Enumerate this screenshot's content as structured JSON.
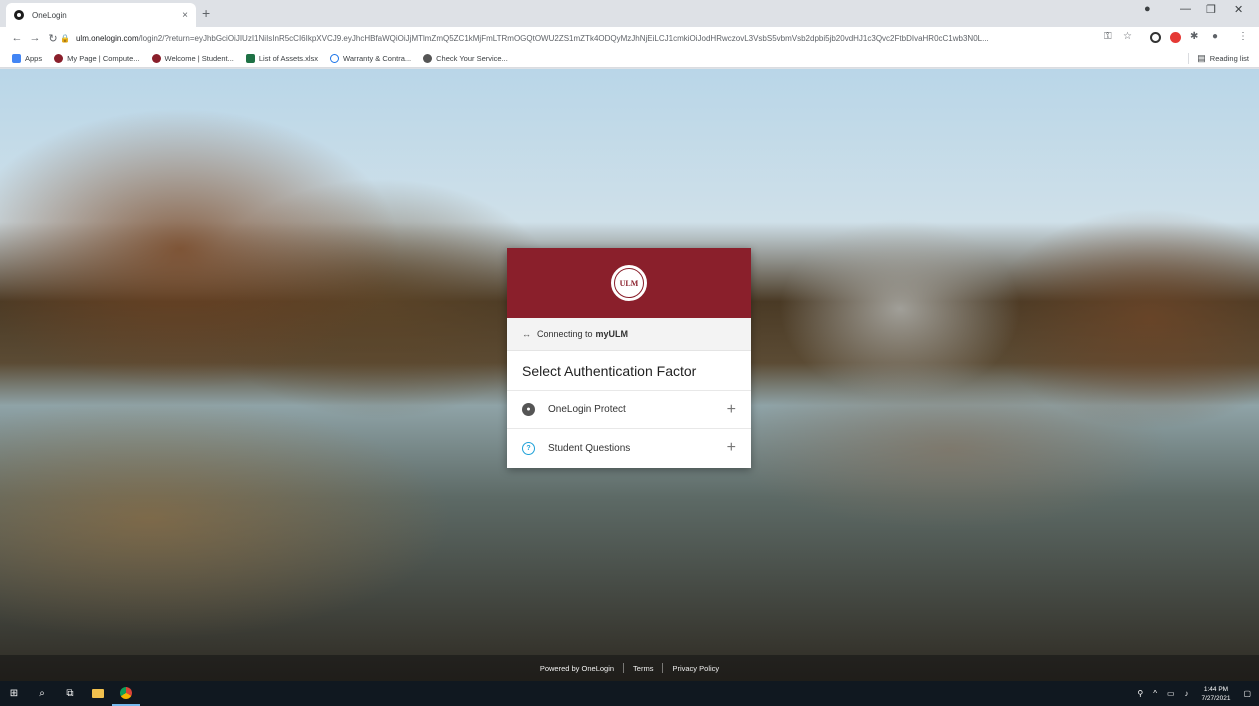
{
  "browser": {
    "tab_title": "OneLogin",
    "tab_close": "×",
    "new_tab": "+",
    "url_host": "ulm.onelogin.com",
    "url_path": "/login2/?return=eyJhbGciOiJIUzI1NiIsInR5cCI6IkpXVCJ9.eyJhcHBfaWQiOiJjMTlmZmQ5ZC1kMjFmLTRmOGQtOWU2ZS1mZTk4ODQyMzJhNjEiLCJ1cmkiOiJodHRwczovL3VsbS5vbmVsb2dpbi5jb20vdHJ1c3Qvc2FtbDIvaHR0cC1wb3N0L..."
  },
  "bookmarks": {
    "items": [
      {
        "label": "Apps",
        "color": "#4285f4"
      },
      {
        "label": "My Page | Compute...",
        "color": "#8a1f2b"
      },
      {
        "label": "Welcome | Student...",
        "color": "#8a1f2b"
      },
      {
        "label": "List of Assets.xlsx",
        "color": "#1e7145"
      },
      {
        "label": "Warranty & Contra...",
        "color": "#1a73e8"
      },
      {
        "label": "Check Your Service...",
        "color": "#555555"
      }
    ],
    "reading_list": "Reading list"
  },
  "card": {
    "logo_text": "ULM",
    "connecting_prefix": "Connecting to",
    "connecting_app": "myULM",
    "title": "Select Authentication Factor",
    "factors": [
      {
        "label": "OneLogin Protect",
        "icon": "onelogin-protect-icon",
        "icon_color": "#555555"
      },
      {
        "label": "Student Questions",
        "icon": "question-icon",
        "icon_color": "#1fa1d8"
      }
    ],
    "expand_symbol": "+",
    "accent_color": "#8a1f2b"
  },
  "footer": {
    "powered_by": "Powered by OneLogin",
    "terms": "Terms",
    "privacy": "Privacy Policy"
  },
  "taskbar": {
    "time": "1:44 PM",
    "date": "7/27/2021"
  }
}
